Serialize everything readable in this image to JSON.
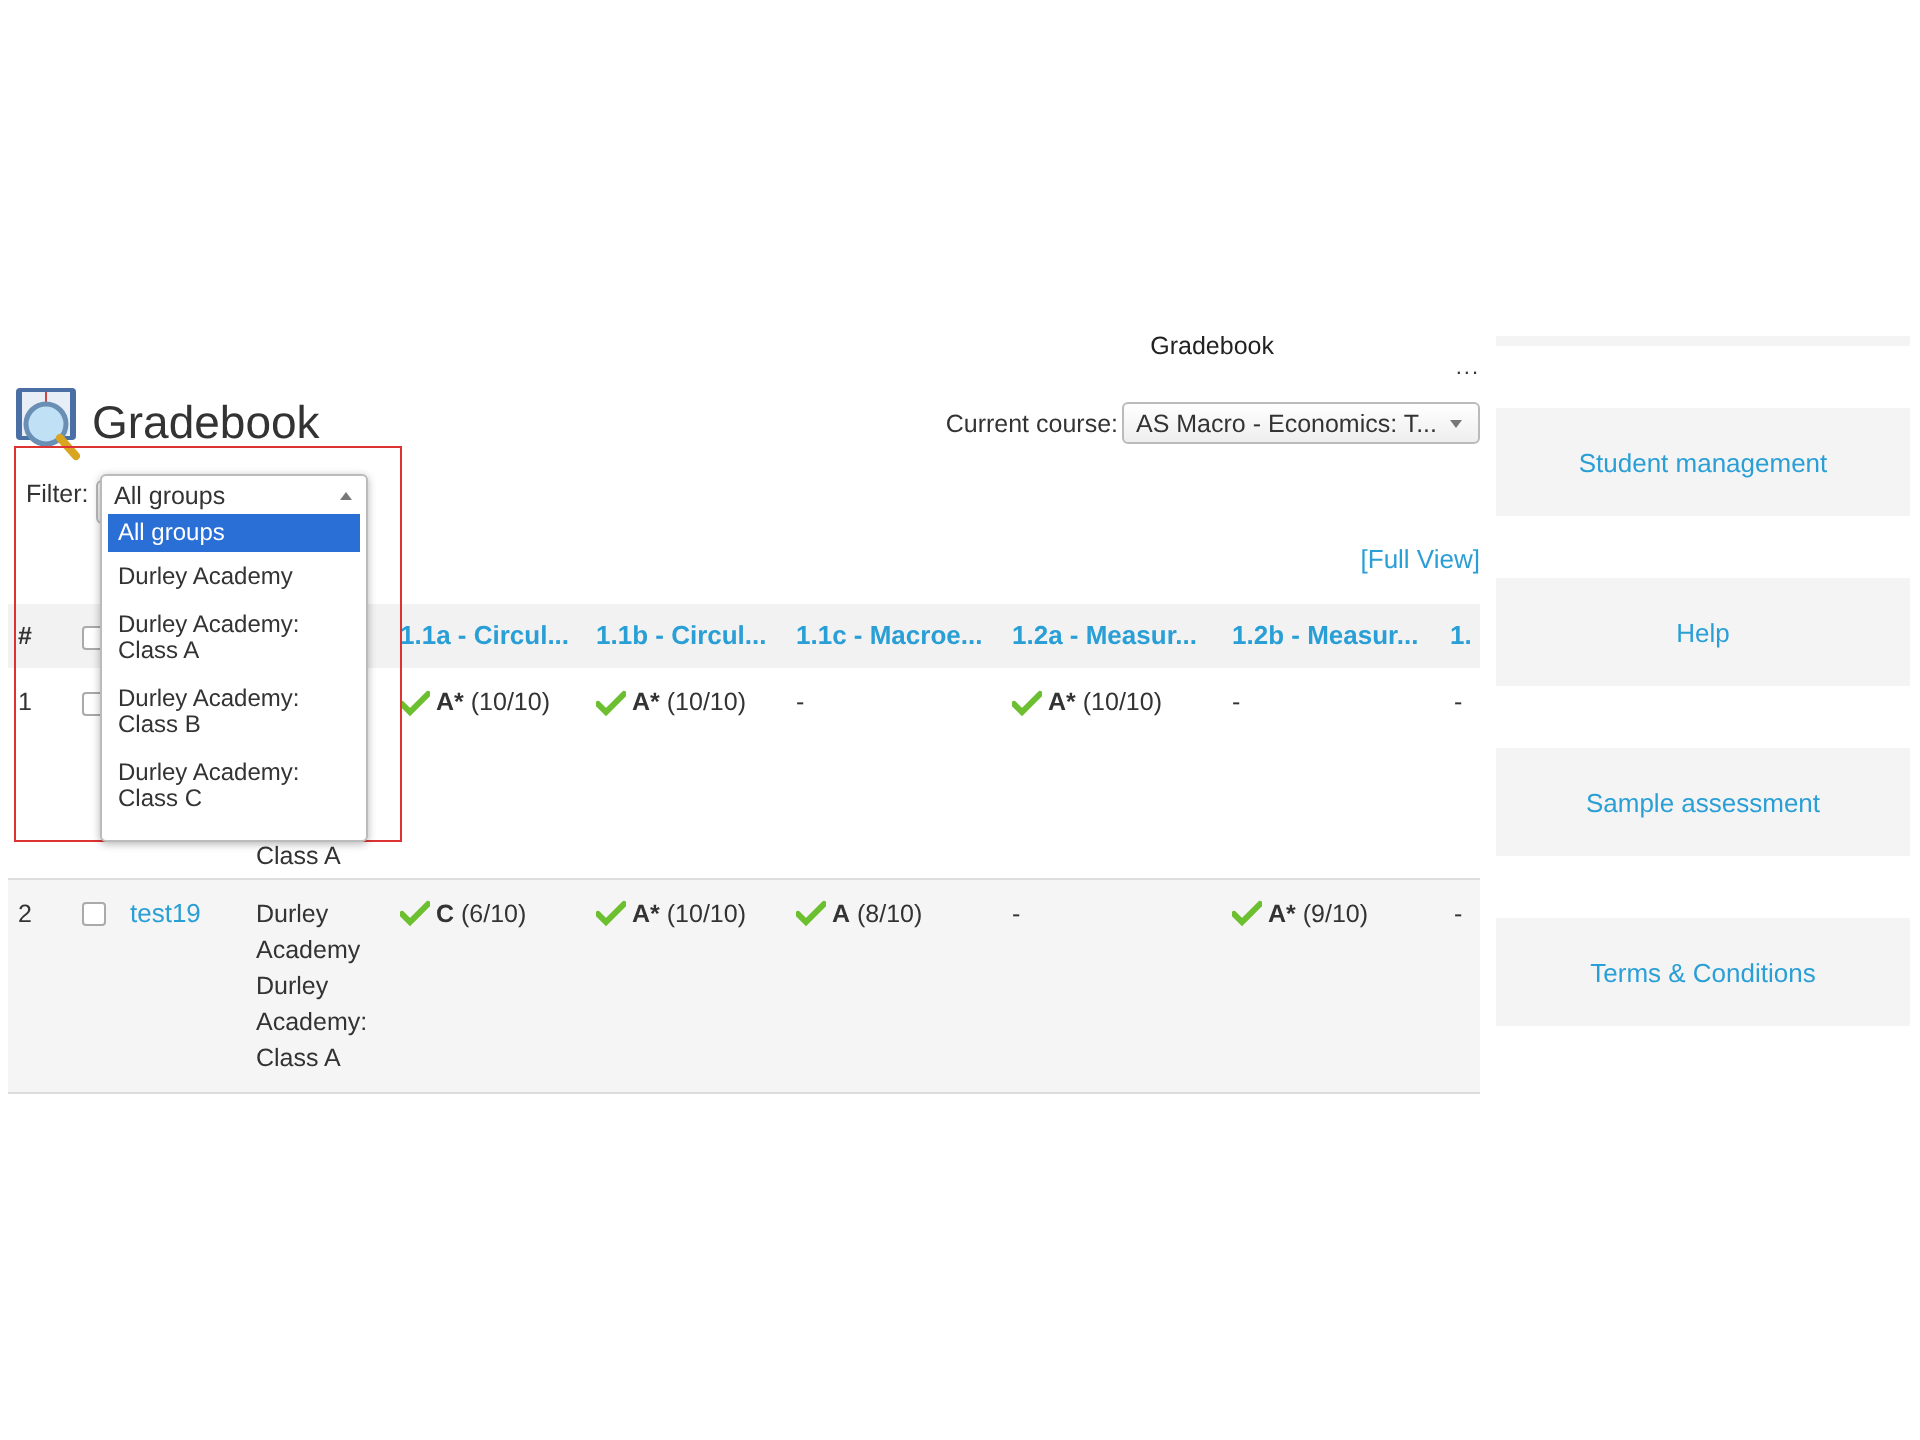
{
  "header": {
    "page_title": "Gradebook",
    "more": "...",
    "heading": "Gradebook",
    "course_label": "Current course:",
    "course_value": "AS Macro - Economics: T..."
  },
  "filter": {
    "label": "Filter:",
    "value": "All groups",
    "expanded": true,
    "options": [
      {
        "label": "All groups",
        "selected": true
      },
      {
        "label": "Durley Academy",
        "selected": false
      },
      {
        "label": "Durley Academy: Class A",
        "selected": false
      },
      {
        "label": "Durley Academy: Class B",
        "selected": false
      },
      {
        "label": "Durley Academy: Class C",
        "selected": false
      }
    ]
  },
  "full_view": "[Full View]",
  "table": {
    "select_all_checked": false,
    "columns": [
      "#",
      "",
      "",
      "",
      "1.1a - Circul...",
      "1.1b - Circul...",
      "1.1c - Macroe...",
      "1.2a - Measur...",
      "1.2b - Measur...",
      "1."
    ],
    "rows": [
      {
        "cells": [
          {
            "kind": "number",
            "text": "1"
          },
          {
            "kind": "checkbox",
            "checked": false
          },
          {
            "kind": "blank"
          },
          {
            "kind": "group",
            "lines": [
              "Class A"
            ]
          },
          {
            "kind": "grade",
            "grade": "A*",
            "score": "(10/10)"
          },
          {
            "kind": "grade",
            "grade": "A*",
            "score": "(10/10)"
          },
          {
            "kind": "empty",
            "text": "-"
          },
          {
            "kind": "grade",
            "grade": "A*",
            "score": "(10/10)"
          },
          {
            "kind": "empty",
            "text": "-"
          },
          {
            "kind": "empty",
            "text": "-"
          }
        ]
      },
      {
        "cells": [
          {
            "kind": "number",
            "text": "2"
          },
          {
            "kind": "checkbox",
            "checked": false
          },
          {
            "kind": "link",
            "text": "test19"
          },
          {
            "kind": "group",
            "lines": [
              "Durley Academy",
              "Durley Academy: Class A"
            ]
          },
          {
            "kind": "grade",
            "grade": "C",
            "score": "(6/10)"
          },
          {
            "kind": "grade",
            "grade": "A*",
            "score": "(10/10)"
          },
          {
            "kind": "grade",
            "grade": "A",
            "score": "(8/10)"
          },
          {
            "kind": "empty",
            "text": "-"
          },
          {
            "kind": "grade",
            "grade": "A*",
            "score": "(9/10)"
          },
          {
            "kind": "empty",
            "text": "-"
          }
        ]
      }
    ]
  },
  "sidebar": {
    "items": [
      "Student management",
      "Help",
      "Sample assessment",
      "Terms & Conditions"
    ]
  }
}
